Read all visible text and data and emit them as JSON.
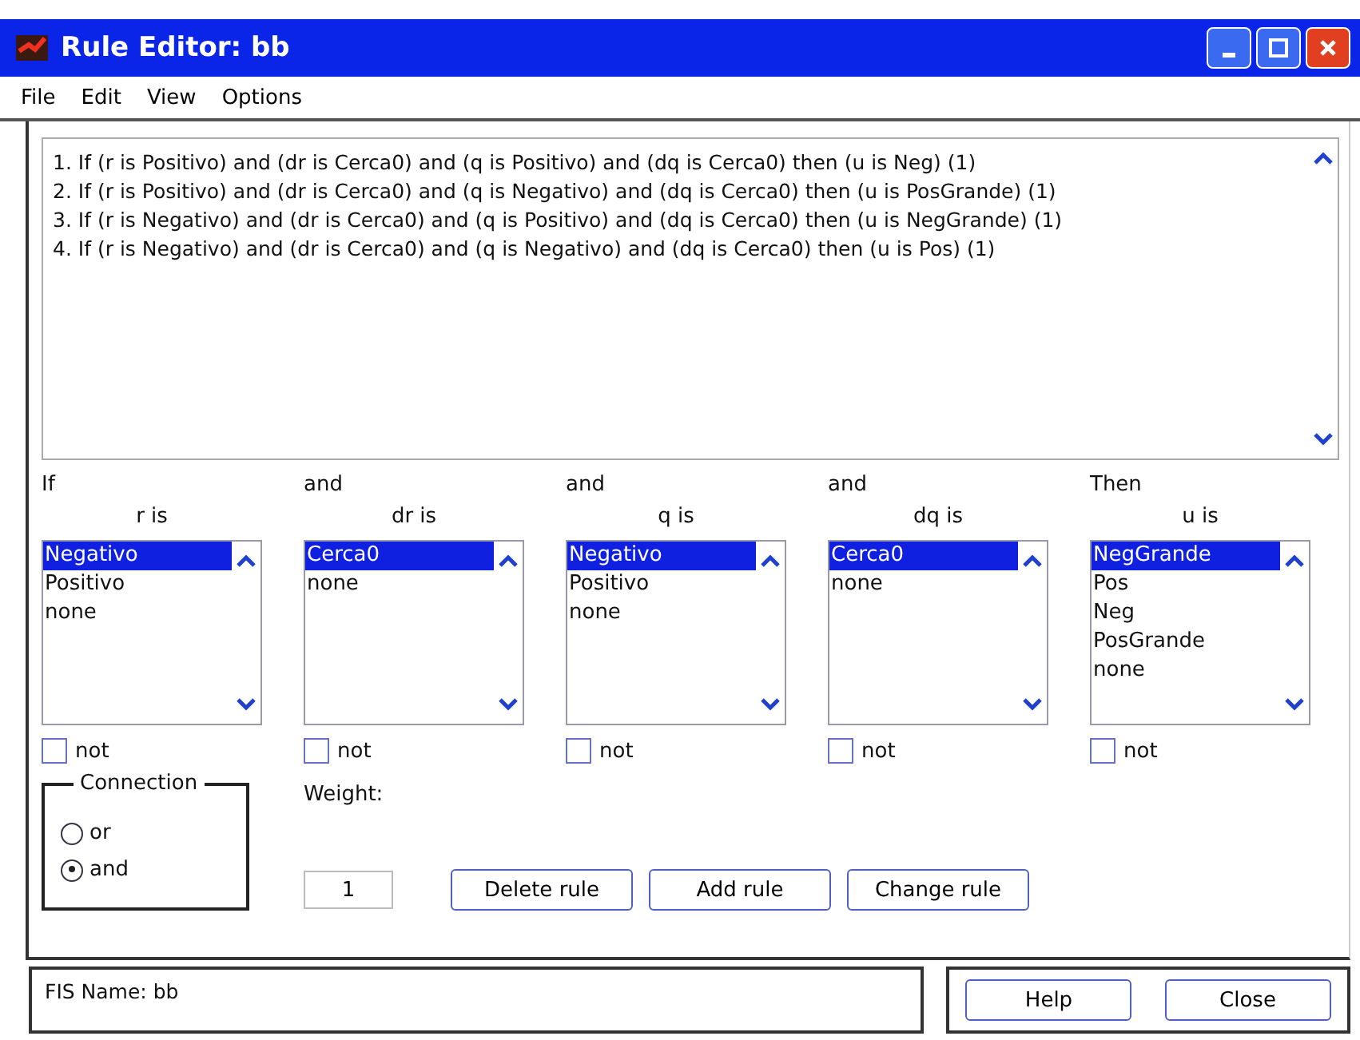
{
  "window": {
    "title": "Rule Editor: bb"
  },
  "menu": [
    "File",
    "Edit",
    "View",
    "Options"
  ],
  "rules": [
    {
      "text": "1. If (r is Positivo) and (dr is Cerca0) and (q is Positivo) and (dq is Cerca0) then (u is Neg) (1)",
      "selected": false
    },
    {
      "text": "2. If (r is Positivo) and (dr is Cerca0) and (q is Negativo) and (dq is Cerca0) then (u is PosGrande) (1)",
      "selected": false
    },
    {
      "text": "3. If (r is Negativo) and (dr is Cerca0) and (q is Positivo) and (dq is Cerca0) then (u is NegGrande) (1)",
      "selected": false
    },
    {
      "text": "4. If (r is Negativo) and (dr is Cerca0) and (q is Negativo) and (dq is Cerca0) then (u is Pos) (1)",
      "selected": false
    }
  ],
  "variables": [
    {
      "connector": "If",
      "label": "r is",
      "not": false,
      "not_label": "not",
      "options": [
        {
          "label": "Negativo",
          "selected": true
        },
        {
          "label": "Positivo",
          "selected": false
        },
        {
          "label": "none",
          "selected": false
        }
      ]
    },
    {
      "connector": "and",
      "label": "dr is",
      "not": false,
      "not_label": "not",
      "options": [
        {
          "label": "Cerca0",
          "selected": true
        },
        {
          "label": "none",
          "selected": false
        }
      ]
    },
    {
      "connector": "and",
      "label": "q is",
      "not": false,
      "not_label": "not",
      "options": [
        {
          "label": "Negativo",
          "selected": true
        },
        {
          "label": "Positivo",
          "selected": false
        },
        {
          "label": "none",
          "selected": false
        }
      ]
    },
    {
      "connector": "and",
      "label": "dq is",
      "not": false,
      "not_label": "not",
      "options": [
        {
          "label": "Cerca0",
          "selected": true
        },
        {
          "label": "none",
          "selected": false
        }
      ]
    },
    {
      "connector": "Then",
      "label": "u is",
      "not": false,
      "not_label": "not",
      "options": [
        {
          "label": "NegGrande",
          "selected": true
        },
        {
          "label": "Pos",
          "selected": false
        },
        {
          "label": "Neg",
          "selected": false
        },
        {
          "label": "PosGrande",
          "selected": false
        },
        {
          "label": "none",
          "selected": false
        }
      ]
    }
  ],
  "connection": {
    "title": "Connection",
    "options": [
      {
        "label": "or",
        "selected": false
      },
      {
        "label": "and",
        "selected": true
      }
    ]
  },
  "weight": {
    "label": "Weight:",
    "value": "1"
  },
  "actions": [
    "Delete rule",
    "Add rule",
    "Change rule"
  ],
  "status": "FIS Name: bb",
  "buttons": [
    "Help",
    "Close"
  ]
}
